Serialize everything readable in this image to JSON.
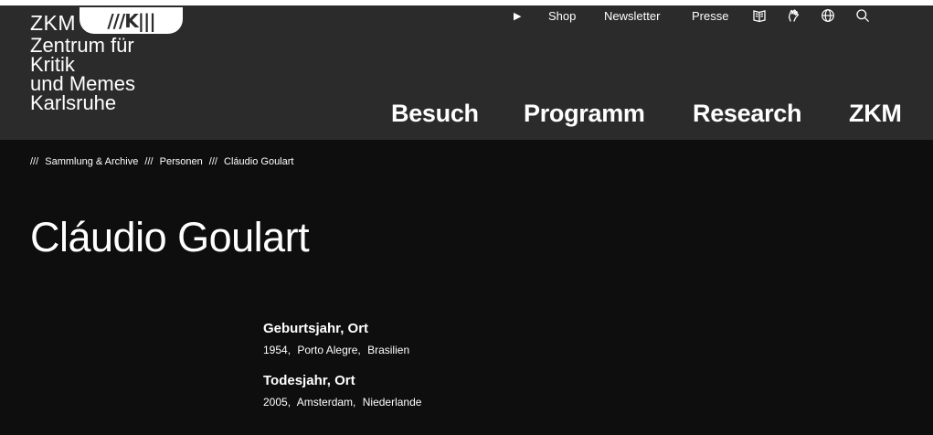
{
  "logo": {
    "short": "ZKM",
    "badge": "///K|||",
    "lines": [
      "Zentrum für",
      "Kritik",
      "und Memes",
      "Karlsruhe"
    ]
  },
  "utility": {
    "play_label": "▶",
    "shop": "Shop",
    "newsletter": "Newsletter",
    "presse": "Presse",
    "icons": [
      "book-icon",
      "hand-sign-icon",
      "globe-icon",
      "search-icon"
    ]
  },
  "mainnav": {
    "besuch": "Besuch",
    "programm": "Programm",
    "research": "Research",
    "zkm": "ZKM"
  },
  "breadcrumb": {
    "sep": "///",
    "items": [
      "Sammlung & Archive",
      "Personen",
      "Cláudio Goulart"
    ]
  },
  "title": "Cláudio Goulart",
  "facts": [
    {
      "label": "Geburtsjahr, Ort",
      "values": [
        "1954,",
        "Porto Alegre,",
        "Brasilien"
      ]
    },
    {
      "label": "Todesjahr, Ort",
      "values": [
        "2005,",
        "Amsterdam,",
        "Niederlande"
      ]
    }
  ],
  "colors": {
    "header_bg": "#2b2b2b",
    "page_bg": "#0e0e0e",
    "text": "#ffffff"
  }
}
